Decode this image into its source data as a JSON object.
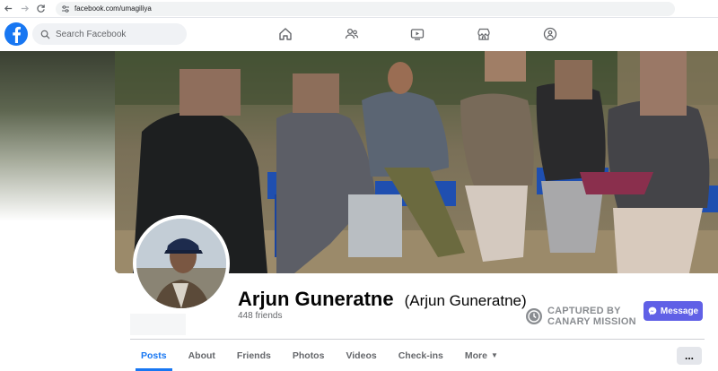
{
  "browser": {
    "url": "facebook.com/umagiliya"
  },
  "header": {
    "search_placeholder": "Search Facebook",
    "nav_icons": [
      "home-icon",
      "friends-icon",
      "watch-icon",
      "marketplace-icon",
      "groups-icon"
    ]
  },
  "profile": {
    "name": "Arjun Guneratne",
    "alternate_name": "(Arjun Guneratne)",
    "friends": "448 friends",
    "message_label": "Message"
  },
  "watermark": {
    "line1": "CAPTURED BY",
    "line2": "CANARY MISSION"
  },
  "tabs": [
    {
      "label": "Posts",
      "active": true
    },
    {
      "label": "About"
    },
    {
      "label": "Friends"
    },
    {
      "label": "Photos"
    },
    {
      "label": "Videos"
    },
    {
      "label": "Check-ins"
    },
    {
      "label": "More"
    }
  ],
  "more_menu_label": "...",
  "colors": {
    "brand": "#1877f2",
    "message_button": "#6060e6",
    "watermark": "#8a8d91"
  }
}
